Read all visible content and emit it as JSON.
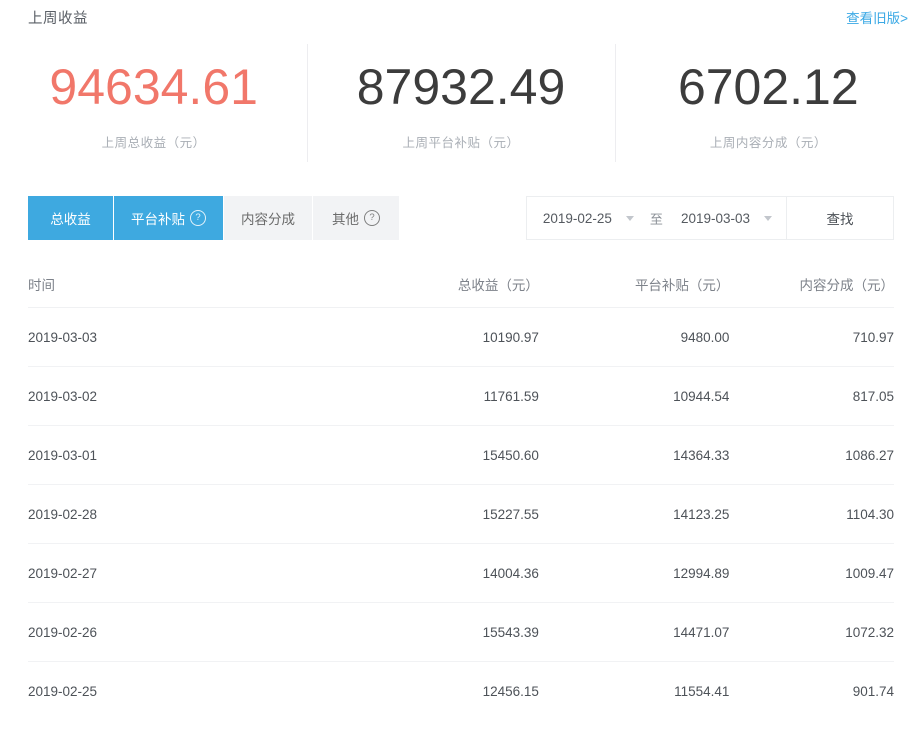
{
  "header": {
    "title": "上周收益",
    "old_version_link": "查看旧版>"
  },
  "stats": [
    {
      "value": "94634.61",
      "label": "上周总收益（元）",
      "color": "#f1776a"
    },
    {
      "value": "87932.49",
      "label": "上周平台补贴（元）",
      "color": "#3c3c3c"
    },
    {
      "value": "6702.12",
      "label": "上周内容分成（元）",
      "color": "#3c3c3c"
    }
  ],
  "tabs": [
    {
      "label": "总收益",
      "active": true,
      "help": false
    },
    {
      "label": "平台补贴",
      "active": true,
      "help": true
    },
    {
      "label": "内容分成",
      "active": false,
      "help": false
    },
    {
      "label": "其他",
      "active": false,
      "help": true
    }
  ],
  "help_icon_glyph": "?",
  "daterange": {
    "start": "2019-02-25",
    "end": "2019-03-03",
    "separator": "至",
    "search_label": "查找"
  },
  "table": {
    "columns": [
      "时间",
      "总收益（元）",
      "平台补贴（元）",
      "内容分成（元）"
    ],
    "rows": [
      [
        "2019-03-03",
        "10190.97",
        "9480.00",
        "710.97"
      ],
      [
        "2019-03-02",
        "11761.59",
        "10944.54",
        "817.05"
      ],
      [
        "2019-03-01",
        "15450.60",
        "14364.33",
        "1086.27"
      ],
      [
        "2019-02-28",
        "15227.55",
        "14123.25",
        "1104.30"
      ],
      [
        "2019-02-27",
        "14004.36",
        "12994.89",
        "1009.47"
      ],
      [
        "2019-02-26",
        "15543.39",
        "14471.07",
        "1072.32"
      ],
      [
        "2019-02-25",
        "12456.15",
        "11554.41",
        "901.74"
      ]
    ]
  },
  "colors": {
    "accent_blue": "#3ea9e0",
    "accent_red": "#f1776a",
    "tab_inactive_bg": "#f2f3f5"
  }
}
